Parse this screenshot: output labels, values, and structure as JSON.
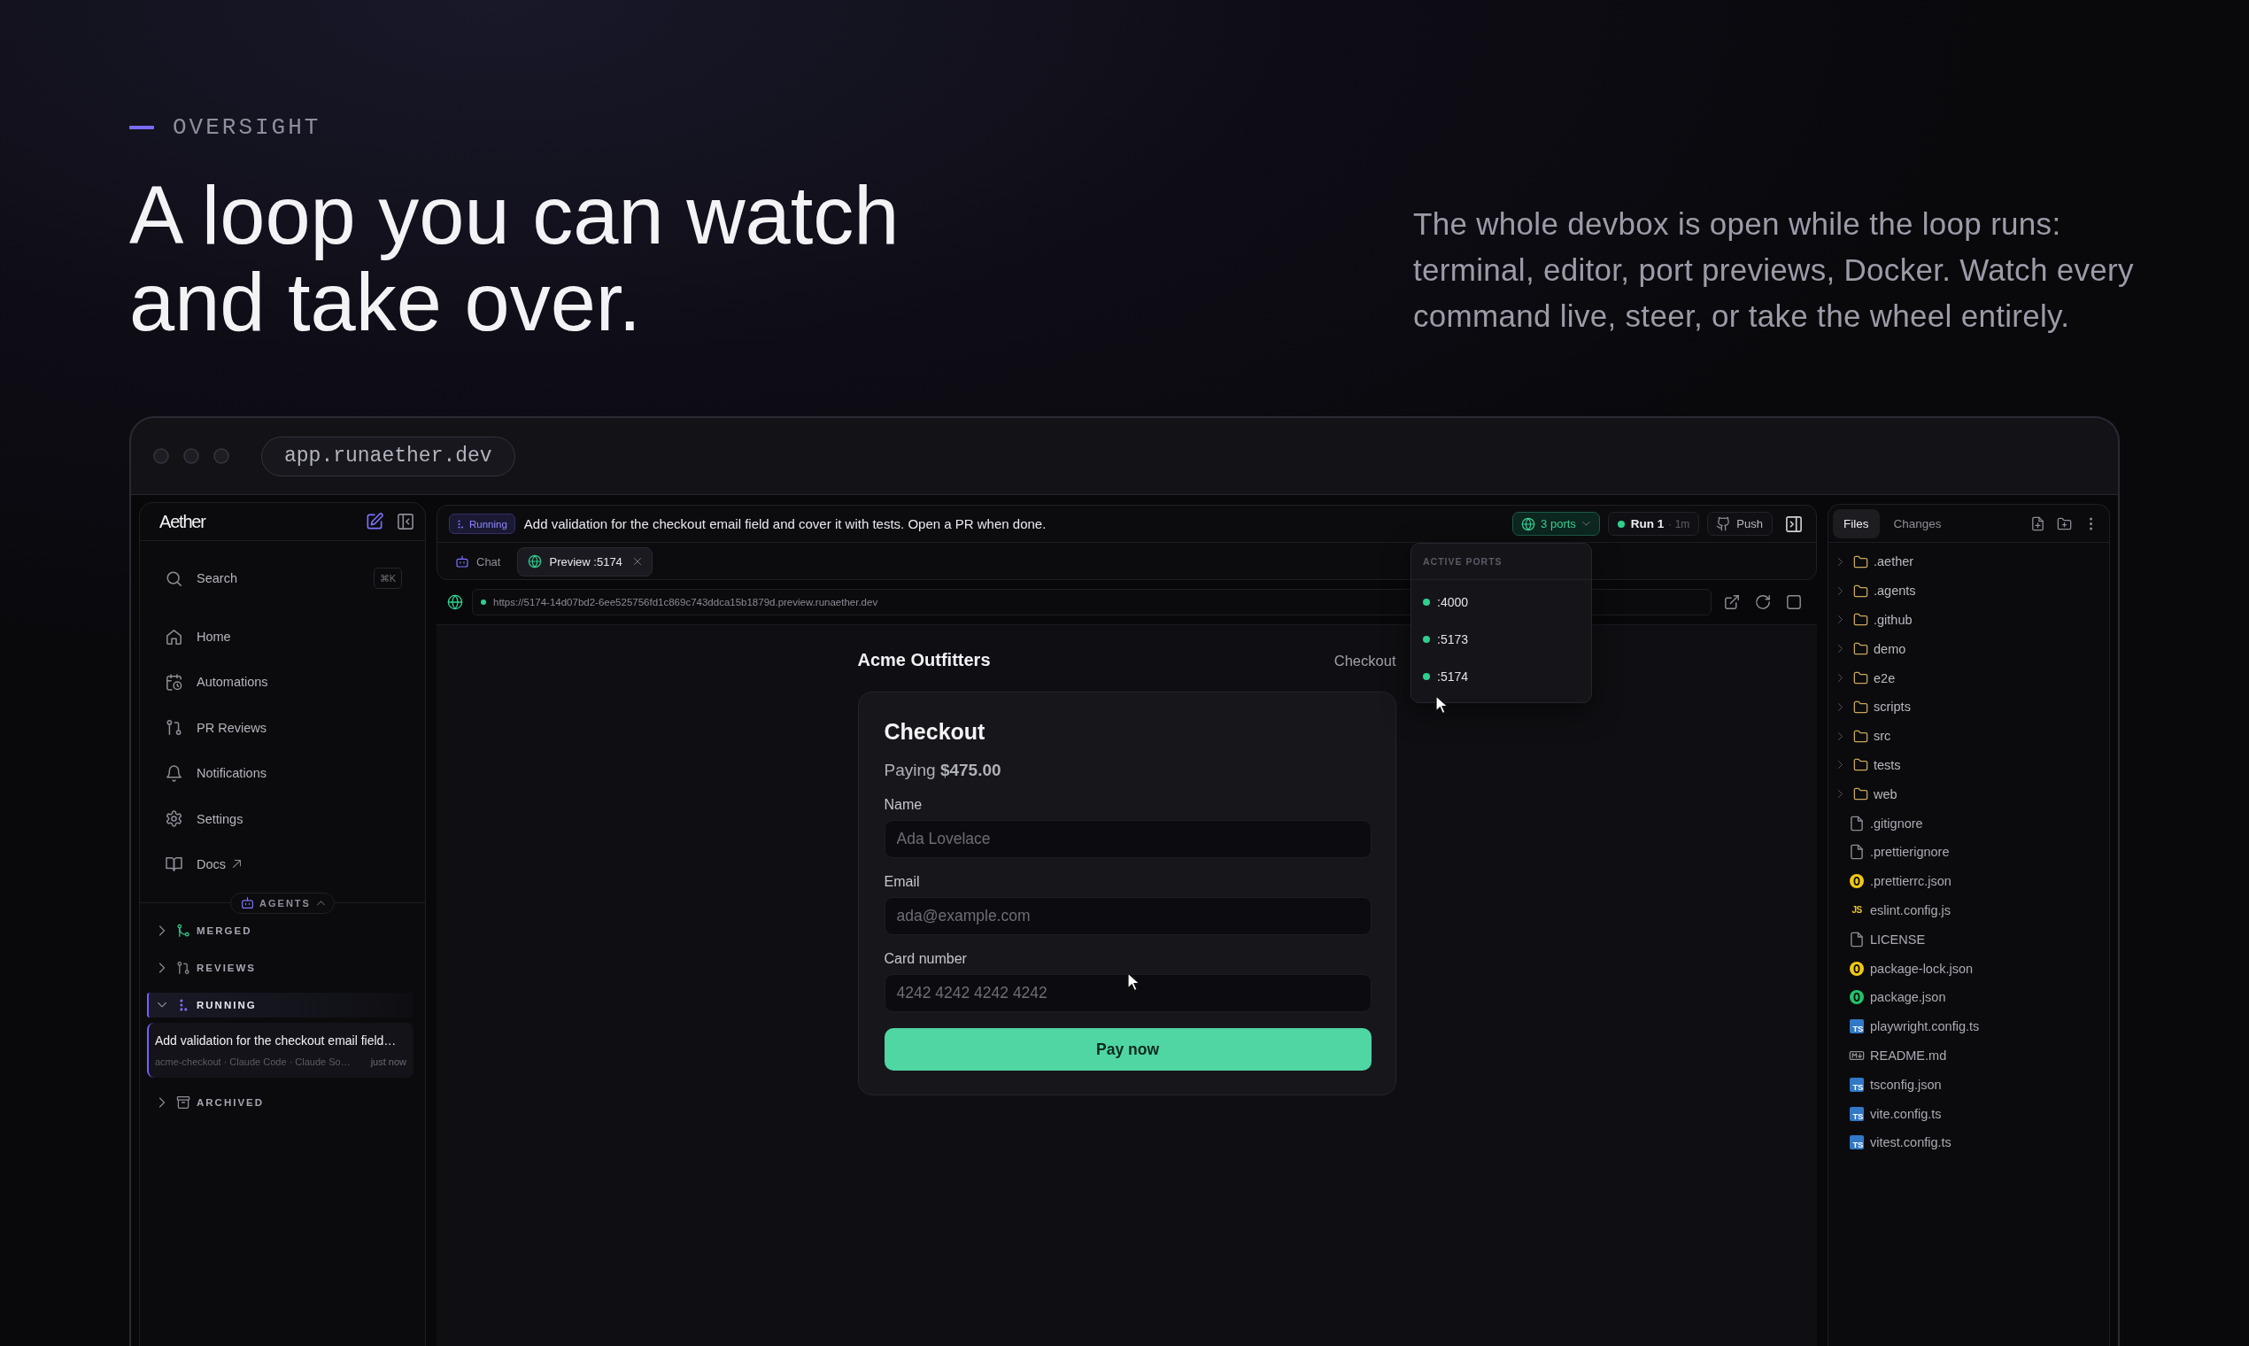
{
  "eyebrow": "OVERSIGHT",
  "headline": "A loop you can watch and take over.",
  "intro": "The whole devbox is open while the loop runs: terminal, editor, port previews, Docker. Watch every command live, steer, or take the wheel entirely.",
  "browser": {
    "address": "app.runaether.dev"
  },
  "sidebar": {
    "logo": "Aether",
    "search": {
      "label": "Search",
      "shortcut": "⌘K"
    },
    "items": [
      {
        "label": "Home",
        "external": false
      },
      {
        "label": "Automations",
        "external": false
      },
      {
        "label": "PR Reviews",
        "external": false
      },
      {
        "label": "Notifications",
        "external": false
      },
      {
        "label": "Settings",
        "external": false
      },
      {
        "label": "Docs",
        "external": true
      }
    ],
    "agents_label": "AGENTS",
    "agents_expanded": true,
    "groups": [
      {
        "label": "MERGED",
        "expanded": false
      },
      {
        "label": "REVIEWS",
        "expanded": false
      },
      {
        "label": "RUNNING",
        "expanded": true,
        "tasks": [
          {
            "title": "Add validation for the checkout email field…",
            "meta": "acme-checkout · Claude Code · Claude So…",
            "time": "just now",
            "selected": true
          }
        ]
      },
      {
        "label": "ARCHIVED",
        "expanded": false
      }
    ]
  },
  "task_bar": {
    "status": "Running",
    "prompt": "Add validation for the checkout email field and cover it with tests. Open a PR when done.",
    "ports_button": {
      "label": "3 ports",
      "expanded": true
    },
    "run_button": {
      "label": "Run 1",
      "elapsed": "· 1m"
    },
    "push_button": {
      "label": "Push"
    },
    "tabs": [
      {
        "label": "Chat",
        "selected": false,
        "closable": false
      },
      {
        "label": "Preview :5174",
        "selected": true,
        "closable": true
      }
    ]
  },
  "ports_menu": {
    "title": "ACTIVE PORTS",
    "ports": [
      ":4000",
      ":5173",
      ":5174"
    ]
  },
  "preview": {
    "url": "https://5174-14d07bd2-6ee525756fd1c869c743ddca15b1879d.preview.runaether.dev",
    "site_name": "Acme Outfitters",
    "nav_link": "Checkout",
    "form": {
      "title": "Checkout",
      "amount": "Paying **$475.00**",
      "fields": [
        {
          "label": "Name",
          "placeholder": "Ada Lovelace"
        },
        {
          "label": "Email",
          "placeholder": "ada@example.com"
        },
        {
          "label": "Card number",
          "placeholder": "4242 4242 4242 4242"
        }
      ],
      "submit": "Pay now"
    }
  },
  "file_panel": {
    "tabs": [
      {
        "label": "Files",
        "selected": true
      },
      {
        "label": "Changes",
        "selected": false
      }
    ],
    "tree": [
      {
        "name": ".aether",
        "kind": "folder"
      },
      {
        "name": ".agents",
        "kind": "folder"
      },
      {
        "name": ".github",
        "kind": "folder"
      },
      {
        "name": "demo",
        "kind": "folder"
      },
      {
        "name": "e2e",
        "kind": "folder"
      },
      {
        "name": "scripts",
        "kind": "folder"
      },
      {
        "name": "src",
        "kind": "folder"
      },
      {
        "name": "tests",
        "kind": "folder"
      },
      {
        "name": "web",
        "kind": "folder"
      },
      {
        "name": ".gitignore",
        "kind": "file"
      },
      {
        "name": ".prettierignore",
        "kind": "file"
      },
      {
        "name": ".prettierrc.json",
        "kind": "json",
        "color": "#f2c811"
      },
      {
        "name": "eslint.config.js",
        "kind": "js",
        "badge": "JS"
      },
      {
        "name": "LICENSE",
        "kind": "file"
      },
      {
        "name": "package-lock.json",
        "kind": "json",
        "color": "#f2c811"
      },
      {
        "name": "package.json",
        "kind": "json",
        "color": "#22c36b"
      },
      {
        "name": "playwright.config.ts",
        "kind": "ts",
        "badge": "TS"
      },
      {
        "name": "README.md",
        "kind": "md"
      },
      {
        "name": "tsconfig.json",
        "kind": "ts",
        "badge": "TS"
      },
      {
        "name": "vite.config.ts",
        "kind": "ts",
        "badge": "TS"
      },
      {
        "name": "vitest.config.ts",
        "kind": "ts",
        "badge": "TS"
      }
    ]
  }
}
